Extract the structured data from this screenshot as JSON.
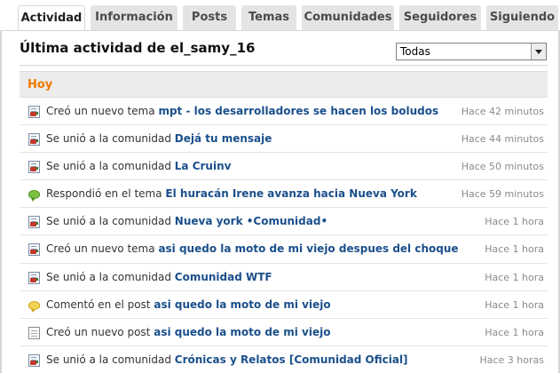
{
  "tabs": [
    {
      "label": "Actividad",
      "active": true
    },
    {
      "label": "Información",
      "active": false
    },
    {
      "label": "Posts",
      "active": false
    },
    {
      "label": "Temas",
      "active": false
    },
    {
      "label": "Comunidades",
      "active": false
    },
    {
      "label": "Seguidores",
      "active": false
    },
    {
      "label": "Siguiendo",
      "active": false
    }
  ],
  "header": {
    "title": "Última actividad de el_samy_16"
  },
  "filter": {
    "selected": "Todas"
  },
  "day_group": {
    "label": "Hoy"
  },
  "activities": [
    {
      "icon": "document-icon",
      "prefix": "Creó un nuevo tema",
      "link": "mpt - los desarrolladores se hacen los boludos",
      "time": "Hace 42 minutos"
    },
    {
      "icon": "document-icon",
      "prefix": "Se unió a la comunidad",
      "link": "Dejá tu mensaje",
      "time": "Hace 44 minutos"
    },
    {
      "icon": "document-icon",
      "prefix": "Se unió a la comunidad",
      "link": "La Cruinv",
      "time": "Hace 50 minutos"
    },
    {
      "icon": "green-speech-bubble-icon",
      "prefix": "Respondió en el tema",
      "link": "El huracán Irene avanza hacia Nueva York",
      "time": "Hace 59 minutos"
    },
    {
      "icon": "document-icon",
      "prefix": "Se unió a la comunidad",
      "link": "Nueva york •Comunidad•",
      "time": "Hace 1 hora"
    },
    {
      "icon": "document-icon",
      "prefix": "Creó un nuevo tema",
      "link": "asi quedo la moto de mi viejo despues del choque",
      "time": "Hace 1 hora"
    },
    {
      "icon": "document-icon",
      "prefix": "Se unió a la comunidad",
      "link": "Comunidad WTF",
      "time": "Hace 1 hora"
    },
    {
      "icon": "yellow-speech-bubble-icon",
      "prefix": "Comentó en el post",
      "link": "asi quedo la moto de mi viejo",
      "time": "Hace 1 hora"
    },
    {
      "icon": "page-icon",
      "prefix": "Creó un nuevo post",
      "link": "asi quedo la moto de mi viejo",
      "time": "Hace 1 hora"
    },
    {
      "icon": "document-icon",
      "prefix": "Se unió a la comunidad",
      "link": "Crónicas y Relatos [Comunidad Oficial]",
      "time": "Hace 3 horas"
    }
  ]
}
